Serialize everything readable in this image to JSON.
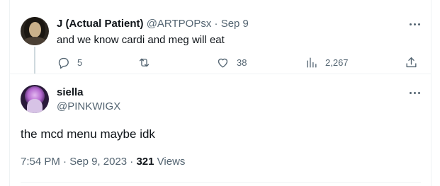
{
  "reply": {
    "display_name": "J (Actual Patient)",
    "handle": "@ARTPOPsx",
    "separator": "·",
    "date": "Sep 9",
    "text": "and we know cardi and meg will eat",
    "actions": {
      "replies": "5",
      "reposts": "",
      "likes": "38",
      "views": "2,267"
    },
    "icons": [
      "comment-icon",
      "repost-icon",
      "heart-icon",
      "analytics-icon",
      "share-icon",
      "more-icon"
    ]
  },
  "main": {
    "display_name": "siella",
    "handle": "@PINKWIGX",
    "text": "the mcd menu maybe idk",
    "time": "7:54 PM",
    "separator": "·",
    "date": "Sep 9, 2023",
    "views_count": "321",
    "views_label": "Views"
  },
  "colors": {
    "text_primary": "#0f1419",
    "text_secondary": "#536471",
    "divider": "#eff3f4",
    "thread_line": "#cfd9de"
  }
}
